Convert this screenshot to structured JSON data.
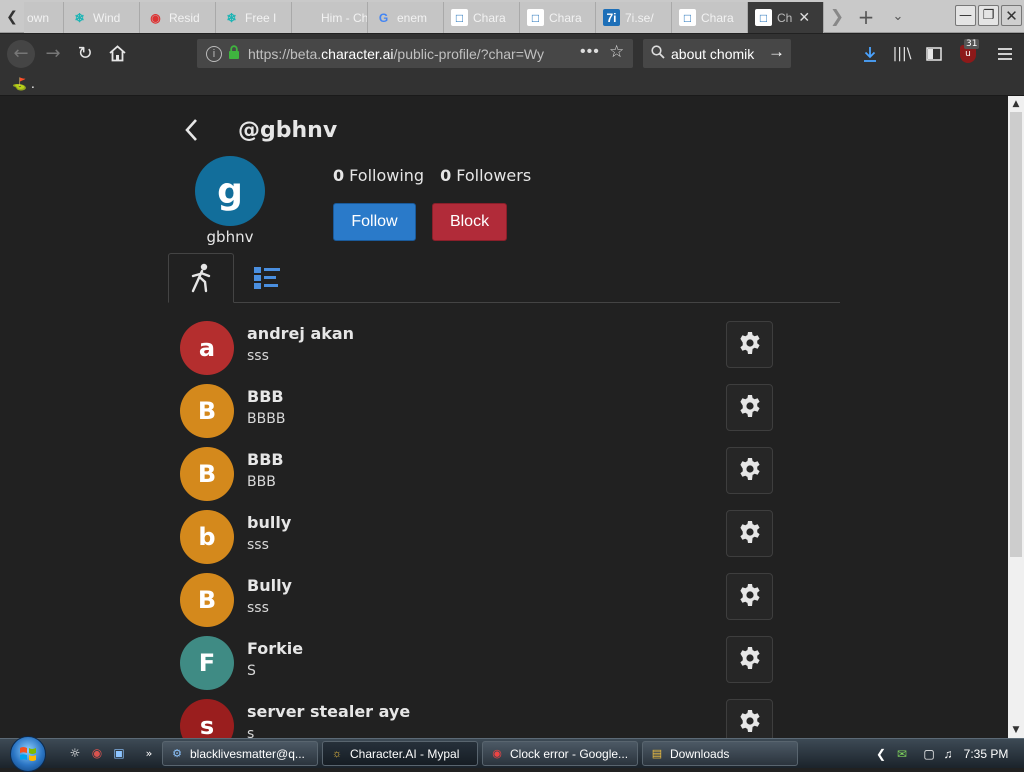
{
  "tabs": [
    {
      "title": "own",
      "icon": "tab-icon-generic"
    },
    {
      "title": "Wind",
      "icon": "tab-icon-snowflake"
    },
    {
      "title": "Resid",
      "icon": "tab-icon-chrome"
    },
    {
      "title": "Free I",
      "icon": "tab-icon-snowflake"
    },
    {
      "title": "Him - Ch",
      "icon": "tab-icon-blank"
    },
    {
      "title": "enem",
      "icon": "tab-icon-google"
    },
    {
      "title": "Chara",
      "icon": "tab-icon-characterai"
    },
    {
      "title": "Chara",
      "icon": "tab-icon-characterai"
    },
    {
      "title": "7i.se/",
      "icon": "tab-icon-7i"
    },
    {
      "title": "Chara",
      "icon": "tab-icon-characterai"
    },
    {
      "title": "Ch",
      "icon": "tab-icon-characterai",
      "active": true
    }
  ],
  "browser": {
    "url_prefix": "https://beta.",
    "url_domain": "character.ai",
    "url_suffix": "/public-profile/?char=Wy",
    "search_value": "about chomik",
    "addon_badge": "31",
    "bookmark_label": "."
  },
  "profile": {
    "handle": "@gbhnv",
    "avatar_letter": "g",
    "avatar_color": "#126e9b",
    "username": "gbhnv",
    "following_count": "0",
    "following_label": "Following",
    "followers_count": "0",
    "followers_label": "Followers",
    "follow_label": "Follow",
    "block_label": "Block"
  },
  "characters": [
    {
      "letter": "a",
      "name": "andrej akan",
      "desc": "sss",
      "color": "#b42e2e"
    },
    {
      "letter": "B",
      "name": "BBB",
      "desc": "BBBB",
      "color": "#d4891c"
    },
    {
      "letter": "B",
      "name": "BBB",
      "desc": "BBB",
      "color": "#d4891c"
    },
    {
      "letter": "b",
      "name": "bully",
      "desc": "sss",
      "color": "#d4891c"
    },
    {
      "letter": "B",
      "name": "Bully",
      "desc": "sss",
      "color": "#d4891c"
    },
    {
      "letter": "F",
      "name": "Forkie",
      "desc": "S",
      "color": "#3f8b84"
    },
    {
      "letter": "s",
      "name": "server stealer aye",
      "desc": "s",
      "color": "#9a1e1e"
    }
  ],
  "taskbar": {
    "items": [
      {
        "label": "blacklivesmatter@q...",
        "icon": "messenger-icon"
      },
      {
        "label": "Character.AI - Mypal",
        "icon": "mypal-icon",
        "active": true
      },
      {
        "label": "Clock error - Google...",
        "icon": "chrome-icon"
      },
      {
        "label": "Downloads",
        "icon": "folder-icon"
      }
    ],
    "clock": "7:35 PM"
  }
}
